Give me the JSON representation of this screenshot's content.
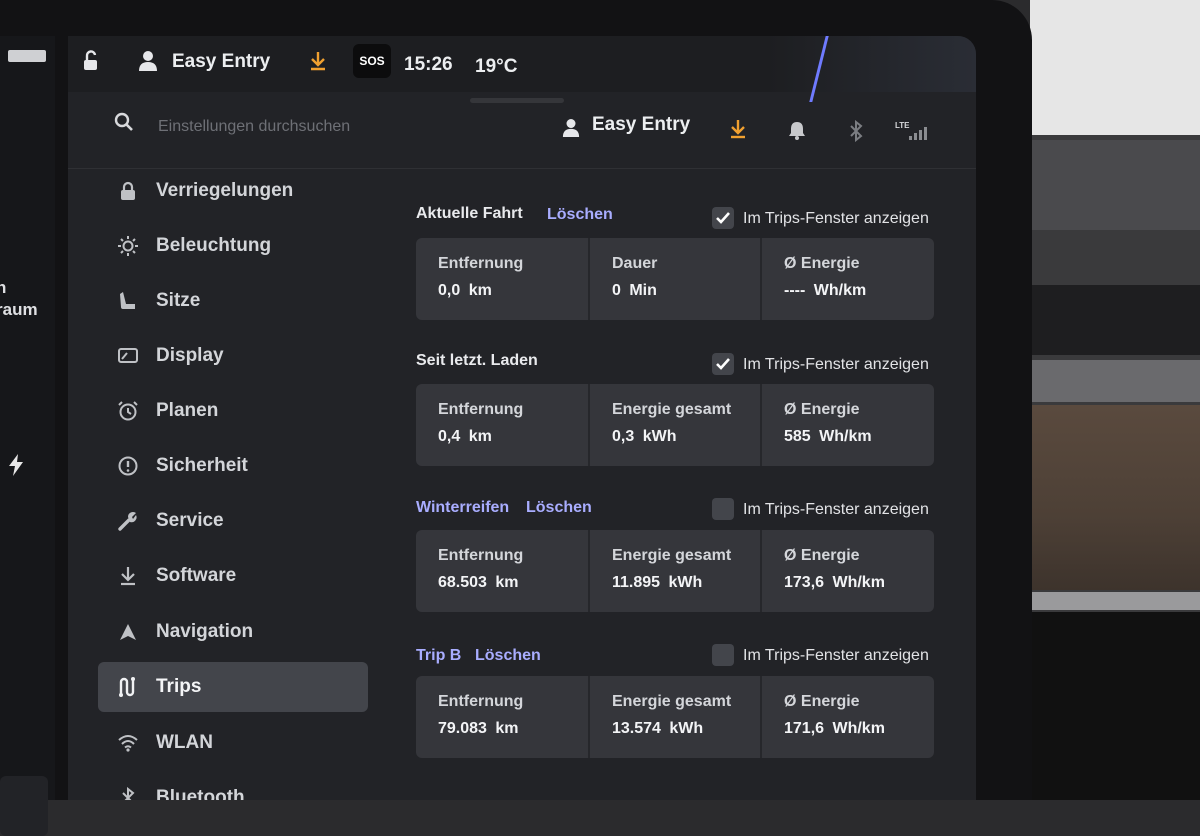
{
  "status_bar": {
    "profile": "Easy Entry",
    "sos": "SOS",
    "time": "15:26",
    "temperature": "19°C"
  },
  "search": {
    "placeholder": "Einstellungen durchsuchen"
  },
  "header": {
    "profile": "Easy Entry",
    "lte": "LTE"
  },
  "left_panel": {
    "text1": "n",
    "text2": "raum"
  },
  "sidebar": {
    "items": [
      {
        "label": "Verriegelungen",
        "icon": "lock-icon"
      },
      {
        "label": "Beleuchtung",
        "icon": "sun-icon"
      },
      {
        "label": "Sitze",
        "icon": "seat-icon"
      },
      {
        "label": "Display",
        "icon": "display-icon"
      },
      {
        "label": "Planen",
        "icon": "alarm-icon"
      },
      {
        "label": "Sicherheit",
        "icon": "alert-icon"
      },
      {
        "label": "Service",
        "icon": "wrench-icon"
      },
      {
        "label": "Software",
        "icon": "download-icon"
      },
      {
        "label": "Navigation",
        "icon": "navigation-icon"
      },
      {
        "label": "Trips",
        "icon": "trips-icon",
        "active": true
      },
      {
        "label": "WLAN",
        "icon": "wifi-icon"
      },
      {
        "label": "Bluetooth",
        "icon": "bluetooth-icon"
      }
    ]
  },
  "trips": [
    {
      "title": "Aktuelle Fahrt",
      "clear": "Löschen",
      "checkbox_label": "Im Trips-Fenster anzeigen",
      "checked": true,
      "cells": [
        {
          "label": "Entfernung",
          "value": "0,0 km"
        },
        {
          "label": "Dauer",
          "value": "0 Min"
        },
        {
          "label": "Ø Energie",
          "value": "---- Wh/km"
        }
      ]
    },
    {
      "title": "Seit letzt. Laden",
      "clear": "",
      "checkbox_label": "Im Trips-Fenster anzeigen",
      "checked": true,
      "cells": [
        {
          "label": "Entfernung",
          "value": "0,4 km"
        },
        {
          "label": "Energie gesamt",
          "value": "0,3 kWh"
        },
        {
          "label": "Ø Energie",
          "value": "585 Wh/km"
        }
      ]
    },
    {
      "title": "Winterreifen",
      "clear": "Löschen",
      "checkbox_label": "Im Trips-Fenster anzeigen",
      "checked": false,
      "cells": [
        {
          "label": "Entfernung",
          "value": "68.503 km"
        },
        {
          "label": "Energie gesamt",
          "value": "11.895 kWh"
        },
        {
          "label": "Ø Energie",
          "value": "173,6 Wh/km"
        }
      ]
    },
    {
      "title": "Trip B",
      "clear": "Löschen",
      "checkbox_label": "Im Trips-Fenster anzeigen",
      "checked": false,
      "cells": [
        {
          "label": "Entfernung",
          "value": "79.083 km"
        },
        {
          "label": "Energie gesamt",
          "value": "13.574 kWh"
        },
        {
          "label": "Ø Energie",
          "value": "171,6 Wh/km"
        }
      ]
    }
  ],
  "colors": {
    "accent": "#a9adff",
    "download": "#f0a030",
    "screen": "#222327"
  }
}
